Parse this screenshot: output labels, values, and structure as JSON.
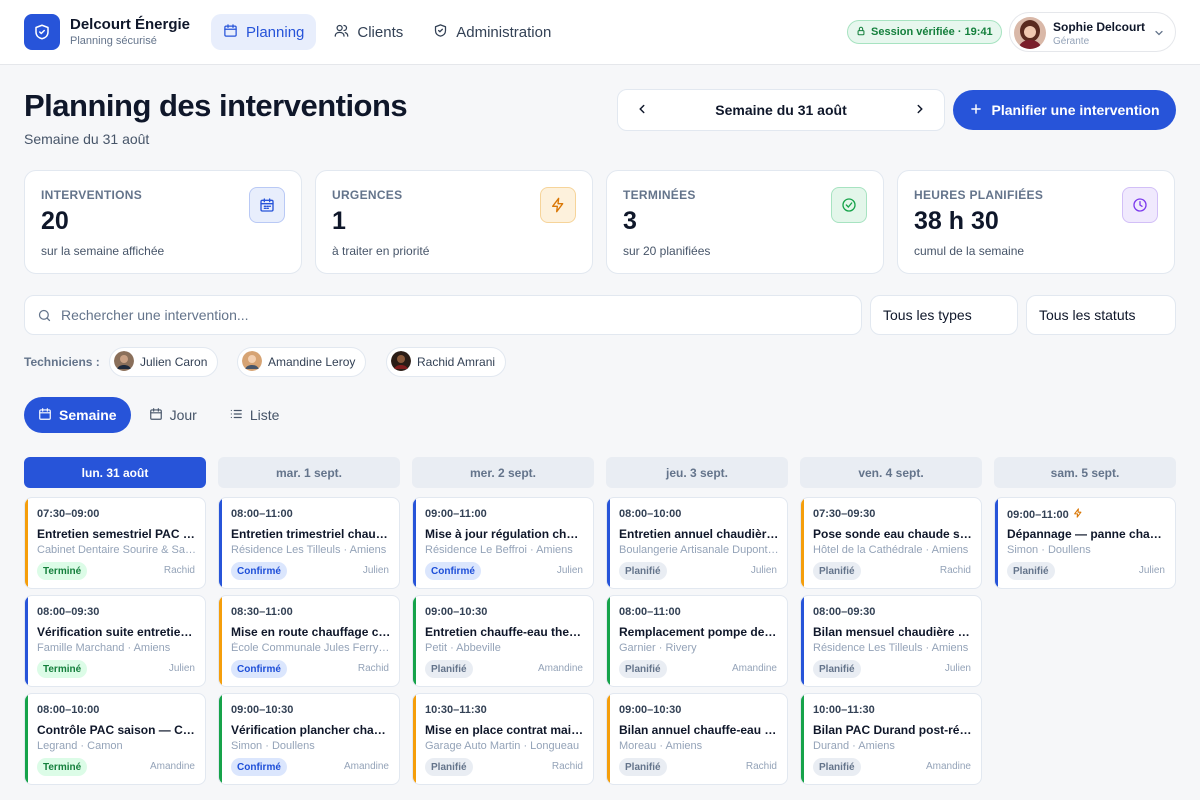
{
  "brand": {
    "name": "Delcourt Énergie",
    "subtitle": "Planning sécurisé"
  },
  "nav": [
    {
      "label": "Planning",
      "icon": "calendar-icon",
      "active": true
    },
    {
      "label": "Clients",
      "icon": "users-icon",
      "active": false
    },
    {
      "label": "Administration",
      "icon": "shield-icon",
      "active": false
    }
  ],
  "session": {
    "label": "Session vérifiée · 19:41"
  },
  "user": {
    "name": "Sophie Delcourt",
    "role": "Gérante"
  },
  "header": {
    "title": "Planning des interventions",
    "subtitle": "Semaine du 31 août",
    "week_label": "Semaine du 31 août",
    "plan_button": "Planifier une intervention"
  },
  "stats": [
    {
      "label": "INTERVENTIONS",
      "value": "20",
      "caption": "sur la semaine affichée",
      "icon": "calendar-icon",
      "color": "#2754d9"
    },
    {
      "label": "URGENCES",
      "value": "1",
      "caption": "à traiter en priorité",
      "icon": "lightning-icon",
      "color": "#d97706"
    },
    {
      "label": "TERMINÉES",
      "value": "3",
      "caption": "sur 20 planifiées",
      "icon": "check-circle-icon",
      "color": "#16a34a"
    },
    {
      "label": "HEURES PLANIFIÉES",
      "value": "38 h 30",
      "caption": "cumul de la semaine",
      "icon": "clock-icon",
      "color": "#7c3aed"
    }
  ],
  "filters": {
    "search_placeholder": "Rechercher une intervention...",
    "type_select": "Tous les types",
    "status_select": "Tous les statuts"
  },
  "technicians": {
    "label": "Techniciens :",
    "items": [
      {
        "name": "Julien Caron"
      },
      {
        "name": "Amandine Leroy"
      },
      {
        "name": "Rachid Amrani"
      }
    ]
  },
  "views": [
    {
      "label": "Semaine",
      "icon": "calendar-icon",
      "active": true
    },
    {
      "label": "Jour",
      "icon": "calendar-day-icon",
      "active": false
    },
    {
      "label": "Liste",
      "icon": "list-icon",
      "active": false
    }
  ],
  "days": [
    {
      "label": "lun. 31 août",
      "active": true,
      "events": [
        {
          "time": "07:30–09:00",
          "title": "Entretien semestriel PAC Daikin",
          "place": "Cabinet Dentaire Sourire & Santé · Amiens",
          "status": "Terminé",
          "tech": "Rachid",
          "accent": "#f59e0b"
        },
        {
          "time": "08:00–09:30",
          "title": "Vérification suite entretien annuel",
          "place": "Famille Marchand · Amiens",
          "status": "Terminé",
          "tech": "Julien",
          "accent": "#2754d9"
        },
        {
          "time": "08:00–10:00",
          "title": "Contrôle PAC saison — Camon",
          "place": "Legrand · Camon",
          "status": "Terminé",
          "tech": "Amandine",
          "accent": "#16a34a"
        }
      ]
    },
    {
      "label": "mar. 1 sept.",
      "active": false,
      "events": [
        {
          "time": "08:00–11:00",
          "title": "Entretien trimestriel chaufferie",
          "place": "Résidence Les Tilleuls · Amiens",
          "status": "Confirmé",
          "tech": "Julien",
          "accent": "#2754d9"
        },
        {
          "time": "08:30–11:00",
          "title": "Mise en route chauffage collectif",
          "place": "École Communale Jules Ferry · Amiens",
          "status": "Confirmé",
          "tech": "Rachid",
          "accent": "#f59e0b"
        },
        {
          "time": "09:00–10:30",
          "title": "Vérification plancher chauffant",
          "place": "Simon · Doullens",
          "status": "Confirmé",
          "tech": "Amandine",
          "accent": "#16a34a"
        }
      ]
    },
    {
      "label": "mer. 2 sept.",
      "active": false,
      "events": [
        {
          "time": "09:00–11:00",
          "title": "Mise à jour régulation chaufferie",
          "place": "Résidence Le Beffroi · Amiens",
          "status": "Confirmé",
          "tech": "Julien",
          "accent": "#2754d9"
        },
        {
          "time": "09:00–10:30",
          "title": "Entretien chauffe-eau thermodynamique",
          "place": "Petit · Abbeville",
          "status": "Planifié",
          "tech": "Amandine",
          "accent": "#16a34a"
        },
        {
          "time": "10:30–11:30",
          "title": "Mise en place contrat maintenance",
          "place": "Garage Auto Martin · Longueau",
          "status": "Planifié",
          "tech": "Rachid",
          "accent": "#f59e0b"
        }
      ]
    },
    {
      "label": "jeu. 3 sept.",
      "active": false,
      "events": [
        {
          "time": "08:00–10:00",
          "title": "Entretien annuel chaudière gaz",
          "place": "Boulangerie Artisanale Dupont · Amiens",
          "status": "Planifié",
          "tech": "Julien",
          "accent": "#2754d9"
        },
        {
          "time": "08:00–11:00",
          "title": "Remplacement pompe de circulation",
          "place": "Garnier · Rivery",
          "status": "Planifié",
          "tech": "Amandine",
          "accent": "#16a34a"
        },
        {
          "time": "09:00–10:30",
          "title": "Bilan annuel chauffe-eau solaire",
          "place": "Moreau · Amiens",
          "status": "Planifié",
          "tech": "Rachid",
          "accent": "#f59e0b"
        }
      ]
    },
    {
      "label": "ven. 4 sept.",
      "active": false,
      "events": [
        {
          "time": "07:30–09:30",
          "title": "Pose sonde eau chaude sanitaire",
          "place": "Hôtel de la Cathédrale · Amiens",
          "status": "Planifié",
          "tech": "Rachid",
          "accent": "#f59e0b"
        },
        {
          "time": "08:00–09:30",
          "title": "Bilan mensuel chaudière collective",
          "place": "Résidence Les Tilleuls · Amiens",
          "status": "Planifié",
          "tech": "Julien",
          "accent": "#2754d9"
        },
        {
          "time": "10:00–11:30",
          "title": "Bilan PAC Durand post-réparation",
          "place": "Durand · Amiens",
          "status": "Planifié",
          "tech": "Amandine",
          "accent": "#16a34a"
        }
      ]
    },
    {
      "label": "sam. 5 sept.",
      "active": false,
      "events": [
        {
          "time": "09:00–11:00",
          "title": "Dépannage — panne chaudière",
          "place": "Simon · Doullens",
          "status": "Planifié",
          "tech": "Julien",
          "accent": "#2754d9",
          "urgent": true
        }
      ]
    }
  ],
  "status_colors": {
    "Terminé": {
      "bg": "#dcfce7",
      "fg": "#15803d"
    },
    "Confirmé": {
      "bg": "#dbe6fd",
      "fg": "#1d4ed8"
    },
    "Planifié": {
      "bg": "#e9edf3",
      "fg": "#64748b"
    }
  }
}
